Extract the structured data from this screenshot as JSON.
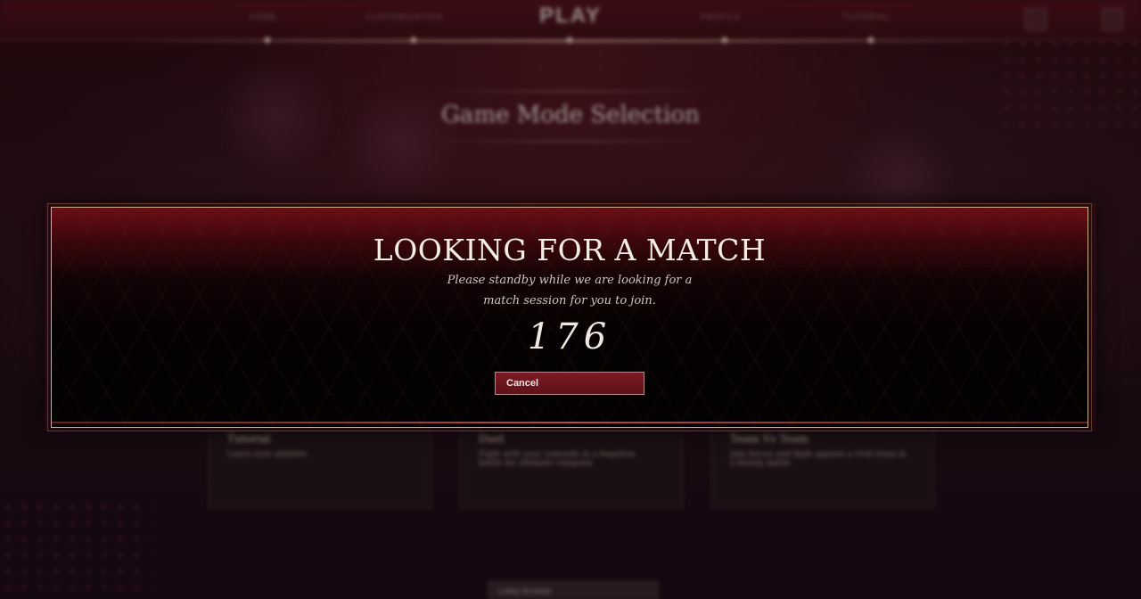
{
  "topnav": {
    "items": [
      "HOME",
      "CUSTOMIZATION",
      "PROFILE",
      "TUTORIAL"
    ],
    "play_label": "PLAY"
  },
  "background": {
    "mode_selection_title": "Game Mode Selection",
    "cards": [
      {
        "title": "Tutorial",
        "subtitle": "Learn your abilities"
      },
      {
        "title": "Duel",
        "subtitle": "Fight with your comrade in a hopeless battle for ultimate conquest"
      },
      {
        "title": "Team Vs Team",
        "subtitle": "Join forces and fight against a rival team in a bloody battle"
      }
    ],
    "bottom_button": "Lobby Browser"
  },
  "modal": {
    "title": "LOOKING FOR A MATCH",
    "line1": "Please standby while we are looking for a",
    "line2": "match session for you to join.",
    "timer": "176",
    "cancel_label": "Cancel"
  },
  "colors": {
    "accent": "#7a1a24",
    "frame_gold": "#c8b08a",
    "text_light": "#f4ede4"
  }
}
